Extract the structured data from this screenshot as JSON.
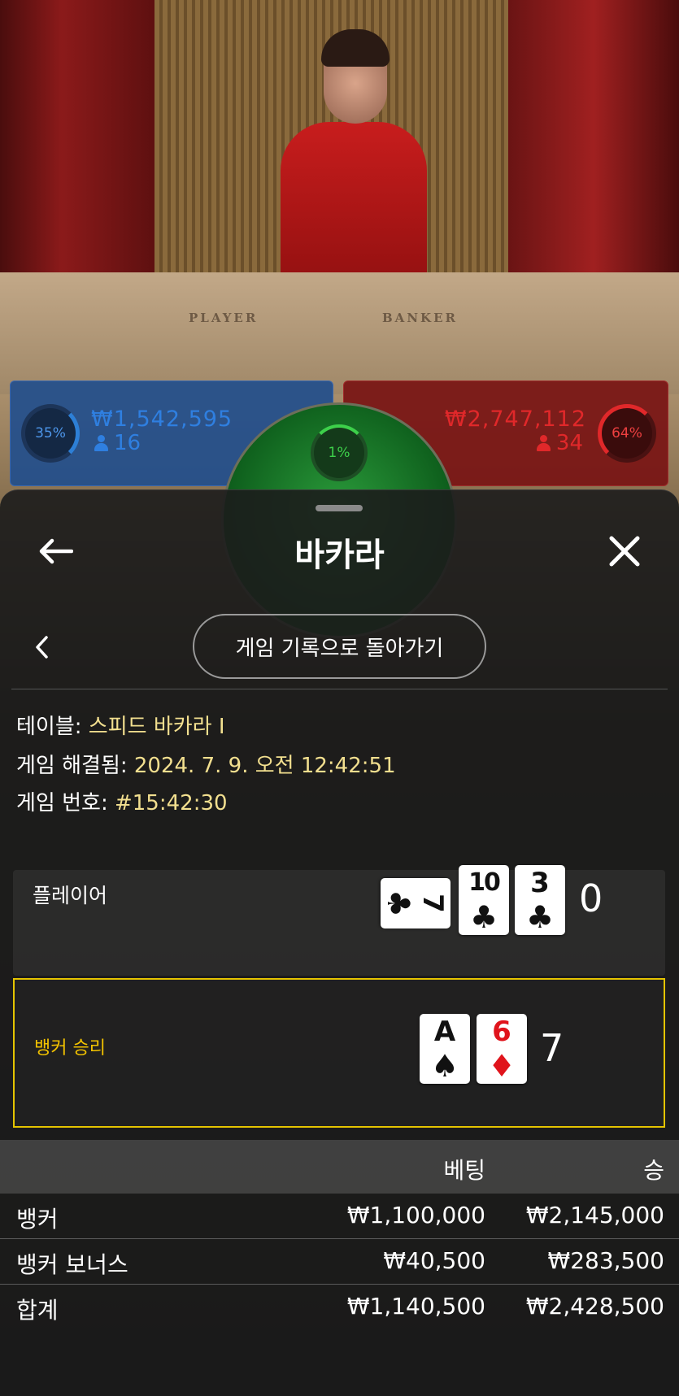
{
  "stream": {
    "felt_player": "PLAYER",
    "felt_banker": "BANKER",
    "player_spot": {
      "percent": "35%",
      "amount": "₩1,542,595",
      "players": "16"
    },
    "banker_spot": {
      "percent": "64%",
      "amount": "₩2,747,112",
      "players": "34"
    },
    "tie_spot": {
      "percent": "1%"
    }
  },
  "sheet": {
    "title": "바카라",
    "return_button": "게임 기록으로 돌아가기",
    "info": {
      "table_label": "테이블: ",
      "table_value": "스피드 바카라 I",
      "resolved_label": "게임 해결됨: ",
      "resolved_value": "2024. 7. 9. 오전 12:42:51",
      "number_label": "게임 번호: ",
      "number_value": "#15:42:30"
    },
    "player_row": {
      "label": "플레이어",
      "score": "0",
      "cards": [
        {
          "rank": "7",
          "suit": "♣",
          "color": "#111111",
          "rotated": true
        },
        {
          "rank": "10",
          "suit": "♣",
          "color": "#111111",
          "rotated": false
        },
        {
          "rank": "3",
          "suit": "♣",
          "color": "#111111",
          "rotated": false
        }
      ]
    },
    "banker_row": {
      "label": "뱅커 승리",
      "label_color": "#f2c200",
      "highlight_color": "#e5c400",
      "score": "7",
      "cards": [
        {
          "rank": "A",
          "suit": "♠",
          "color": "#111111",
          "rotated": false
        },
        {
          "rank": "6",
          "suit": "♦",
          "color": "#e0141c",
          "rotated": false
        }
      ]
    },
    "bets": {
      "header_bet": "베팅",
      "header_win": "승",
      "rows": [
        {
          "name": "뱅커",
          "bet": "₩1,100,000",
          "win": "₩2,145,000"
        },
        {
          "name": "뱅커 보너스",
          "bet": "₩40,500",
          "win": "₩283,500"
        },
        {
          "name": "합계",
          "bet": "₩1,140,500",
          "win": "₩2,428,500"
        }
      ]
    }
  },
  "colors": {
    "player_blue": "#2f7fe0",
    "banker_red": "#e0282a",
    "tie_green": "#3dd04a",
    "info_value": "#f2df8f"
  }
}
